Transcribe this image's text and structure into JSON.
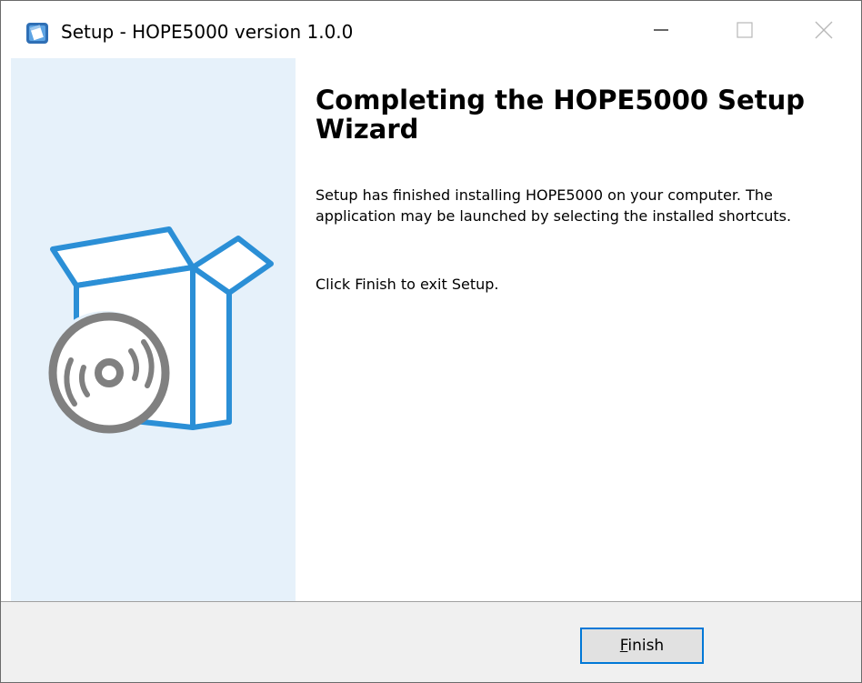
{
  "window": {
    "title": "Setup - HOPE5000 version 1.0.0",
    "controls": {
      "minimize": "minimize",
      "maximize": "maximize",
      "close": "close"
    }
  },
  "icons": {
    "app": "setup-app-icon",
    "illustration": "software-box-disc-icon"
  },
  "wizard": {
    "heading": "Completing the HOPE5000 Setup Wizard",
    "paragraphs": [
      "Setup has finished installing HOPE5000 on your computer. The application may be launched by selecting the installed shortcuts.",
      "Click Finish to exit Setup."
    ]
  },
  "buttons": {
    "finish": {
      "mnemonic": "F",
      "rest": "inish"
    }
  },
  "colors": {
    "accent": "#0078d7",
    "side_panel": "#e6f1fa",
    "illustration_blue": "#2b8fd6",
    "disc_gray": "#808080"
  }
}
